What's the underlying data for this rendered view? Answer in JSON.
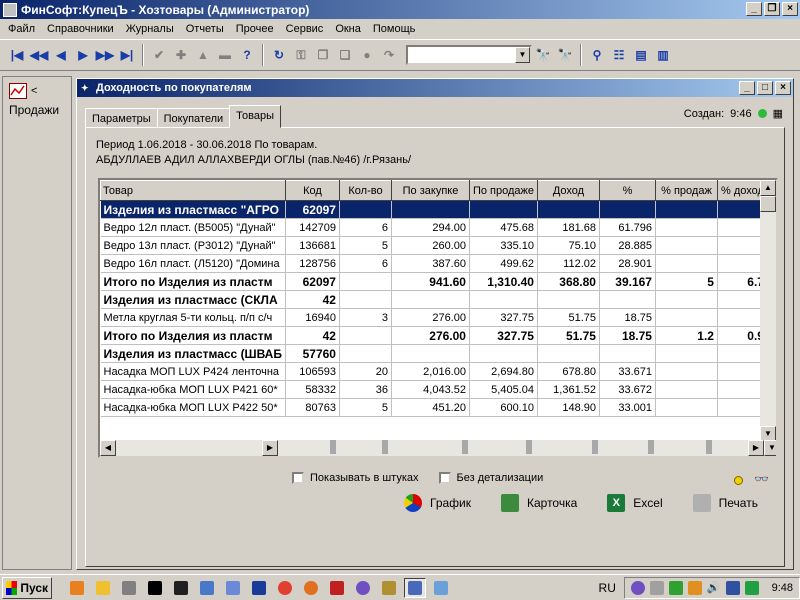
{
  "app": {
    "title": "ФинСофт:КупецЪ - Хозтовары  (Администратор)",
    "menu": [
      "Файл",
      "Справочники",
      "Журналы",
      "Отчеты",
      "Прочее",
      "Сервис",
      "Окна",
      "Помощь"
    ]
  },
  "sidebar": {
    "item_label": "Продажи"
  },
  "window": {
    "title": "Доходность по покупателям",
    "tabs": [
      "Параметры",
      "Покупатели",
      "Товары"
    ],
    "active_tab": "Товары",
    "created_label": "Создан:",
    "created_time": "9:46",
    "period_line": "Период  1.06.2018 - 30.06.2018 По товарам.",
    "customer_line": "АБДУЛЛАЕВ АДИЛ АЛЛАХВЕРДИ ОГЛЫ (пав.№46) /г.Рязань/"
  },
  "table": {
    "columns": [
      "Товар",
      "Код",
      "Кол-во",
      "По закупке",
      "По продаже",
      "Доход",
      "%",
      "% продаж",
      "% доход"
    ],
    "rows": [
      {
        "type": "group",
        "selected": true,
        "cells": [
          "Изделия из пластмасс \"АГРО",
          "62097",
          "",
          "",
          "",
          "",
          "",
          "",
          ""
        ]
      },
      {
        "type": "item",
        "cells": [
          "Ведро 12л пласт. (В5005) \"Дунай\"",
          "142709",
          "6",
          "294.00",
          "475.68",
          "181.68",
          "61.796",
          "",
          ""
        ]
      },
      {
        "type": "item",
        "cells": [
          "Ведро 13л пласт. (Р3012) \"Дунай\"",
          "136681",
          "5",
          "260.00",
          "335.10",
          "75.10",
          "28.885",
          "",
          ""
        ]
      },
      {
        "type": "item",
        "cells": [
          "Ведро 16л пласт. (Л5120) \"Домина",
          "128756",
          "6",
          "387.60",
          "499.62",
          "112.02",
          "28.901",
          "",
          ""
        ]
      },
      {
        "type": "total",
        "cells": [
          "Итого по Изделия из пластм",
          "62097",
          "",
          "941.60",
          "1,310.40",
          "368.80",
          "39.167",
          "5",
          "6.7"
        ]
      },
      {
        "type": "group",
        "cells": [
          "Изделия из пластмасс (СКЛА",
          "42",
          "",
          "",
          "",
          "",
          "",
          "",
          ""
        ]
      },
      {
        "type": "item",
        "cells": [
          "Метла круглая 5-ти кольц. п/п с/ч",
          "16940",
          "3",
          "276.00",
          "327.75",
          "51.75",
          "18.75",
          "",
          ""
        ]
      },
      {
        "type": "total",
        "cells": [
          "Итого по Изделия из пластм",
          "42",
          "",
          "276.00",
          "327.75",
          "51.75",
          "18.75",
          "1.2",
          "0.9"
        ]
      },
      {
        "type": "group",
        "cells": [
          "Изделия из пластмасс (ШВАБ",
          "57760",
          "",
          "",
          "",
          "",
          "",
          "",
          ""
        ]
      },
      {
        "type": "item",
        "cells": [
          "Насадка МОП LUX P424 ленточна",
          "106593",
          "20",
          "2,016.00",
          "2,694.80",
          "678.80",
          "33.671",
          "",
          ""
        ]
      },
      {
        "type": "item",
        "cells": [
          "Насадка-юбка МОП LUX P421  60*",
          "58332",
          "36",
          "4,043.52",
          "5,405.04",
          "1,361.52",
          "33.672",
          "",
          ""
        ]
      },
      {
        "type": "item",
        "cells": [
          "Насадка-юбка МОП LUX P422  50*",
          "80763",
          "5",
          "451.20",
          "600.10",
          "148.90",
          "33.001",
          "",
          ""
        ]
      }
    ]
  },
  "options": {
    "show_pieces": "Показывать в штуках",
    "no_detail": "Без детализации"
  },
  "actions": {
    "chart": "График",
    "card": "Карточка",
    "excel": "Excel",
    "print": "Печать"
  },
  "taskbar": {
    "start": "Пуск",
    "lang": "RU",
    "time": "9:48"
  },
  "colors": {
    "title_start": "#0a246a",
    "title_end": "#a6caf0",
    "selection": "#0a246a",
    "status_ok": "#2dbb3a"
  }
}
